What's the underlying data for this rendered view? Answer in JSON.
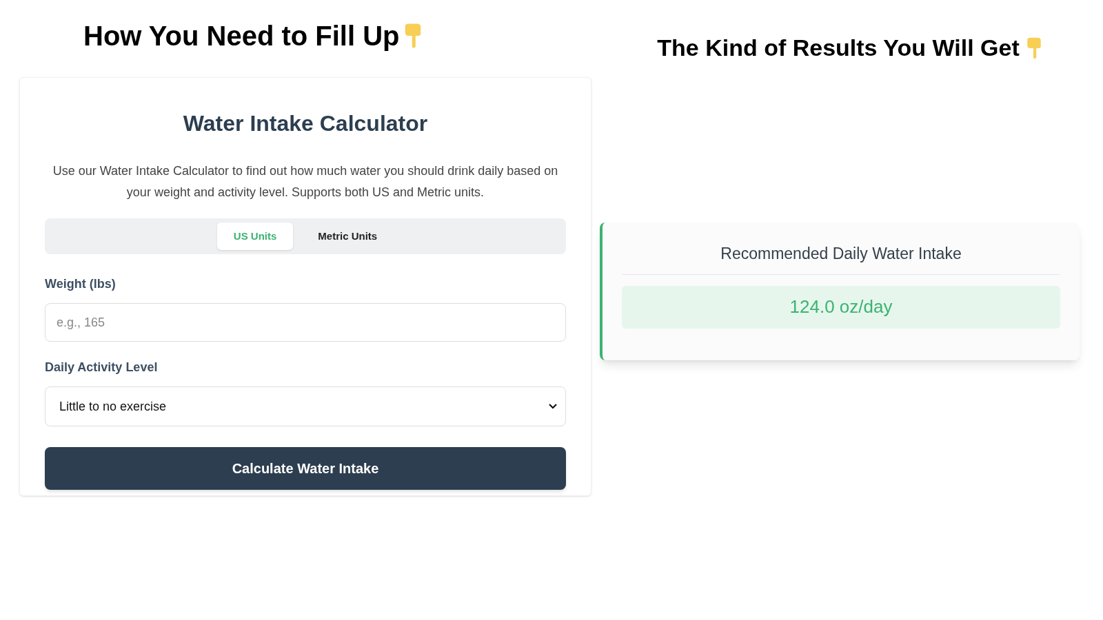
{
  "left_heading": "How You Need to Fill Up",
  "right_heading": "The Kind of Results You Will Get",
  "calculator": {
    "title": "Water Intake Calculator",
    "description": "Use our Water Intake Calculator to find out how much water you should drink daily based on your weight and activity level. Supports both US and Metric units.",
    "tabs": [
      {
        "label": "US Units",
        "selected": true
      },
      {
        "label": "Metric Units",
        "selected": false
      }
    ],
    "weight": {
      "label": "Weight (lbs)",
      "placeholder": "e.g., 165"
    },
    "activity": {
      "label": "Daily Activity Level",
      "value": "Little to no exercise"
    },
    "button": "Calculate Water Intake"
  },
  "result": {
    "title": "Recommended Daily Water Intake",
    "value": "124.0 oz/day"
  }
}
